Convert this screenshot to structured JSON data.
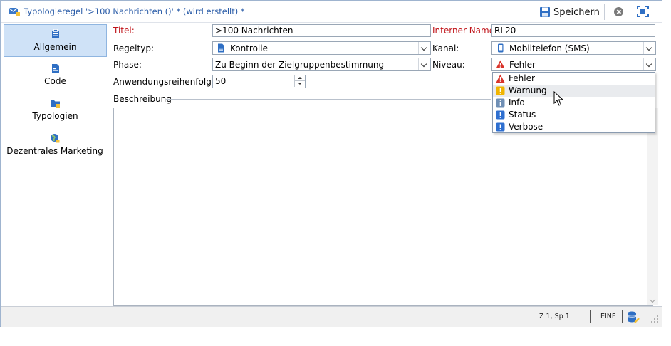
{
  "window": {
    "title": "Typologieregel '>100 Nachrichten ()' * (wird erstellt) *",
    "save_label": "Speichern"
  },
  "nav": {
    "items": [
      {
        "label": "Allgemein",
        "icon": "clipboard-icon",
        "active": true
      },
      {
        "label": "Code",
        "icon": "code-file-icon",
        "active": false
      },
      {
        "label": "Typologien",
        "icon": "folder-icon",
        "active": false
      },
      {
        "label": "Dezentrales Marketing",
        "icon": "globe-icon",
        "active": false
      }
    ]
  },
  "form": {
    "title_label": "Titel:",
    "title_value": ">100 Nachrichten",
    "internal_name_label": "Interner Name:",
    "internal_name_value": "RL20",
    "rule_type_label": "Regeltyp:",
    "rule_type_value": "Kontrolle",
    "channel_label": "Kanal:",
    "channel_value": "Mobiltelefon (SMS)",
    "phase_label": "Phase:",
    "phase_value": "Zu Beginn der Zielgruppenbestimmung",
    "level_label": "Niveau:",
    "level_value": "Fehler",
    "order_label": "Anwendungsreihenfolge:",
    "order_value": "50",
    "description_label": "Beschreibung"
  },
  "level_dropdown": {
    "options": [
      {
        "label": "Fehler",
        "icon": "error-triangle-icon"
      },
      {
        "label": "Warnung",
        "icon": "warning-icon"
      },
      {
        "label": "Info",
        "icon": "info-icon"
      },
      {
        "label": "Status",
        "icon": "status-icon"
      },
      {
        "label": "Verbose",
        "icon": "verbose-icon"
      }
    ],
    "hovered_index": 1
  },
  "status": {
    "position": "Z 1, Sp 1",
    "insert_mode": "EINF"
  },
  "colors": {
    "title_text": "#2a5ca8",
    "required_label": "#c0141a",
    "nav_active_bg": "#cfe2f7",
    "error": "#d9342b",
    "warning": "#f0b400",
    "info": "#6f8fb5",
    "status": "#2e6fd0"
  }
}
